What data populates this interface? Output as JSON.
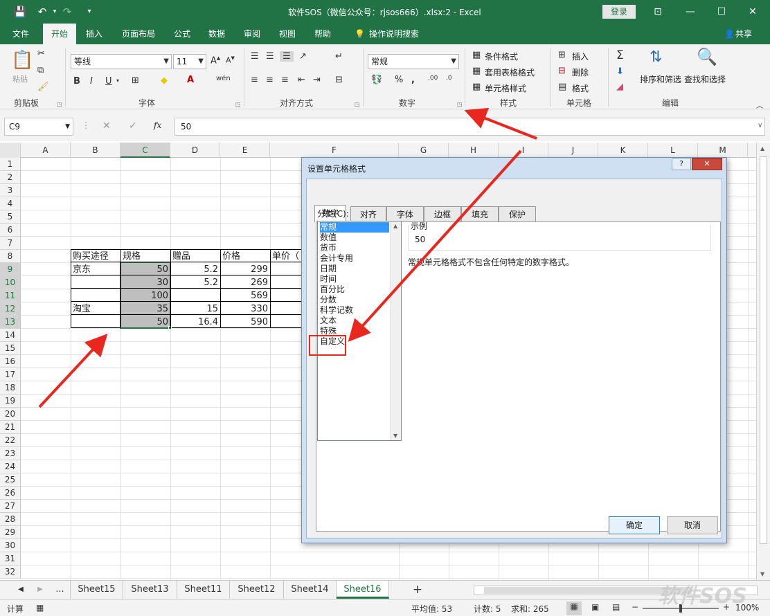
{
  "titlebar": {
    "title": "软件SOS（微信公众号：rjsos666）.xlsx:2  -  Excel",
    "login": "登录"
  },
  "menu": {
    "tabs": [
      "文件",
      "开始",
      "插入",
      "页面布局",
      "公式",
      "数据",
      "审阅",
      "视图",
      "帮助"
    ],
    "tell_me": "操作说明搜索",
    "share": "共享"
  },
  "ribbon": {
    "clipboard": {
      "paste": "粘贴",
      "label": "剪贴板"
    },
    "font": {
      "name": "等线",
      "size": "11",
      "label": "字体",
      "bold": "B",
      "italic": "I",
      "underline": "U"
    },
    "alignment": {
      "label": "对齐方式"
    },
    "number": {
      "format": "常规",
      "label": "数字"
    },
    "styles": {
      "conditional": "条件格式",
      "table": "套用表格格式",
      "cell": "单元格样式",
      "label": "样式"
    },
    "cells": {
      "insert": "插入",
      "delete": "删除",
      "format": "格式",
      "label": "单元格"
    },
    "editing": {
      "sort": "排序和筛选",
      "find": "查找和选择",
      "label": "编辑"
    }
  },
  "formula_bar": {
    "name_box": "C9",
    "value": "50",
    "fx": "fx"
  },
  "columns": [
    "A",
    "B",
    "C",
    "D",
    "E",
    "F",
    "G",
    "H",
    "I",
    "J",
    "K",
    "L",
    "M"
  ],
  "rows": [
    "1",
    "2",
    "3",
    "4",
    "5",
    "6",
    "7",
    "8",
    "9",
    "10",
    "11",
    "12",
    "13",
    "14",
    "15",
    "16",
    "17",
    "18",
    "19",
    "20",
    "21",
    "22",
    "23",
    "24",
    "25",
    "26",
    "27",
    "28",
    "29",
    "30",
    "31",
    "32"
  ],
  "table": {
    "headers": [
      "购买途径",
      "规格",
      "赠品",
      "价格",
      "单价（"
    ],
    "rows": [
      [
        "京东",
        "50",
        "5.2",
        "299",
        ""
      ],
      [
        "",
        "30",
        "5.2",
        "269",
        ""
      ],
      [
        "",
        "100",
        "",
        "569",
        ""
      ],
      [
        "淘宝",
        "35",
        "15",
        "330",
        ""
      ],
      [
        "",
        "50",
        "16.4",
        "590",
        ""
      ]
    ]
  },
  "dialog": {
    "title": "设置单元格格式",
    "help": "?",
    "close": "✕",
    "tabs": [
      "数字",
      "对齐",
      "字体",
      "边框",
      "填充",
      "保护"
    ],
    "category_label": "分类(C):",
    "categories": [
      "常规",
      "数值",
      "货币",
      "会计专用",
      "日期",
      "时间",
      "百分比",
      "分数",
      "科学记数",
      "文本",
      "特殊",
      "自定义"
    ],
    "sample_label": "示例",
    "sample_value": "50",
    "description": "常规单元格格式不包含任何特定的数字格式。",
    "ok": "确定",
    "cancel": "取消"
  },
  "sheets": {
    "more": "...",
    "tabs": [
      "Sheet15",
      "Sheet13",
      "Sheet11",
      "Sheet12",
      "Sheet14",
      "Sheet16"
    ],
    "add": "+"
  },
  "status": {
    "mode": "计算",
    "average": "平均值: 53",
    "count": "计数: 5",
    "sum": "求和: 265",
    "zoom": "100%"
  },
  "watermark": "软件SOS",
  "colors": {
    "excel_green": "#217346",
    "annotation_red": "#e8281e",
    "selection_blue": "#3399ff"
  }
}
